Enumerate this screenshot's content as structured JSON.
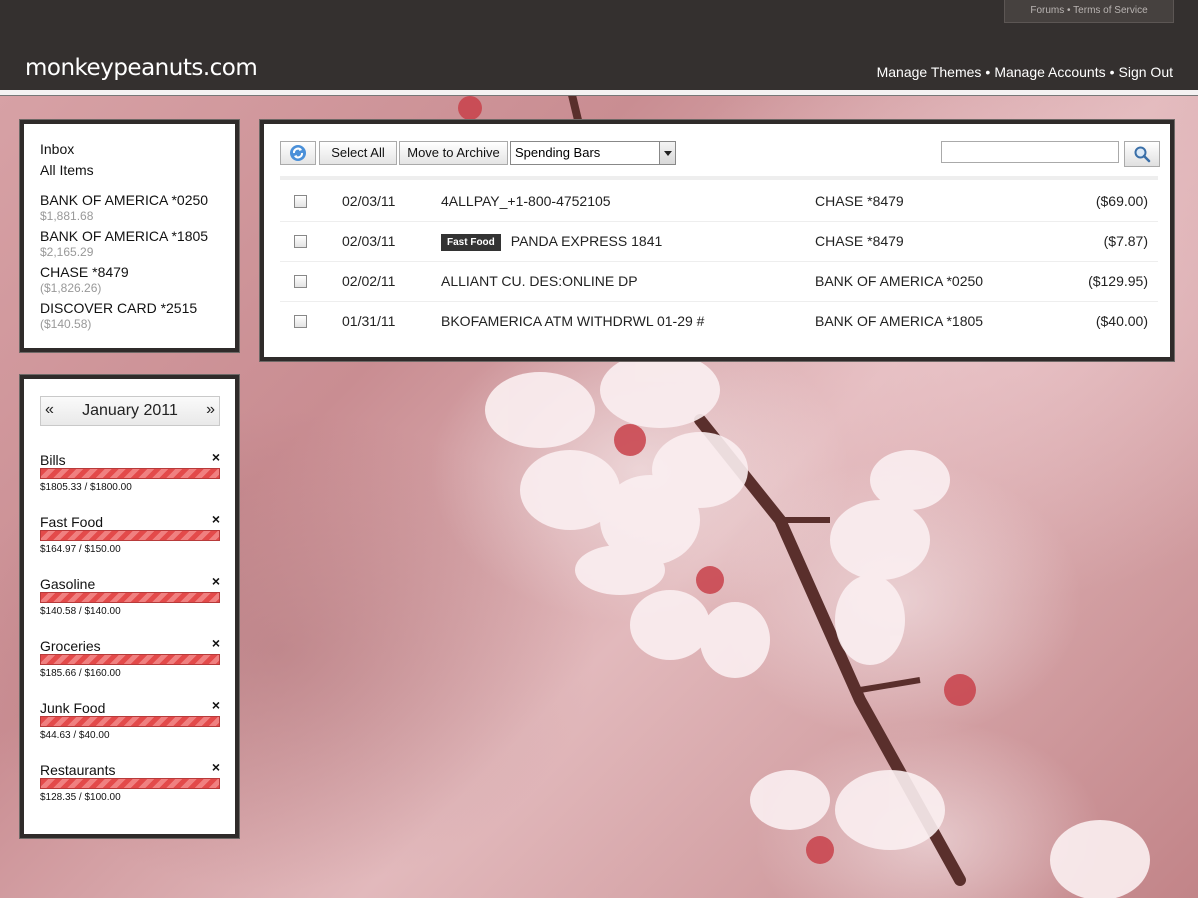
{
  "site": {
    "logo": "monkeypeanuts.com",
    "top_links": {
      "forums": "Forums",
      "separator": "•",
      "terms": "Terms of Service"
    },
    "nav": [
      {
        "label": "Manage Themes"
      },
      {
        "label": "Manage Accounts"
      },
      {
        "label": "Sign Out"
      }
    ],
    "nav_separator": "•"
  },
  "sidebar": {
    "inbox_label": "Inbox",
    "all_items_label": "All Items",
    "accounts": [
      {
        "name": "BANK OF AMERICA *0250",
        "balance": "$1,881.68"
      },
      {
        "name": "BANK OF AMERICA *1805",
        "balance": "$2,165.29"
      },
      {
        "name": "CHASE *8479",
        "balance": "($1,826.26)"
      },
      {
        "name": "DISCOVER CARD *2515",
        "balance": "($140.58)"
      }
    ]
  },
  "budget": {
    "prev": "«",
    "month": "January 2011",
    "next": "»",
    "remove_glyph": "×",
    "categories": [
      {
        "name": "Bills",
        "amount": "$1805.33 / $1800.00",
        "progress": 1.0
      },
      {
        "name": "Fast Food",
        "amount": "$164.97 / $150.00",
        "progress": 1.0
      },
      {
        "name": "Gasoline",
        "amount": "$140.58 / $140.00",
        "progress": 1.0
      },
      {
        "name": "Groceries",
        "amount": "$185.66 / $160.00",
        "progress": 1.0
      },
      {
        "name": "Junk Food",
        "amount": "$44.63 / $40.00",
        "progress": 1.0
      },
      {
        "name": "Restaurants",
        "amount": "$128.35 / $100.00",
        "progress": 1.0
      }
    ]
  },
  "toolbar": {
    "refresh_icon": "refresh-icon",
    "select_all": "Select All",
    "move_to_archive": "Move to Archive",
    "view_select": "Spending Bars",
    "search_value": "",
    "search_icon": "search-icon"
  },
  "transactions": [
    {
      "date": "02/03/11",
      "tag": "",
      "description": "4ALLPAY_+1-800-4752105",
      "account": "CHASE *8479",
      "amount": "($69.00)"
    },
    {
      "date": "02/03/11",
      "tag": "Fast Food",
      "description": "PANDA EXPRESS 1841",
      "account": "CHASE *8479",
      "amount": "($7.87)"
    },
    {
      "date": "02/02/11",
      "tag": "",
      "description": "ALLIANT CU. DES:ONLINE DP",
      "account": "BANK OF AMERICA *0250",
      "amount": "($129.95)"
    },
    {
      "date": "01/31/11",
      "tag": "",
      "description": "BKOFAMERICA ATM WITHDRWL 01-29 #",
      "account": "BANK OF AMERICA *1805",
      "amount": "($40.00)"
    }
  ],
  "colors": {
    "bar": "#e34a4a",
    "header": "#34302f"
  }
}
